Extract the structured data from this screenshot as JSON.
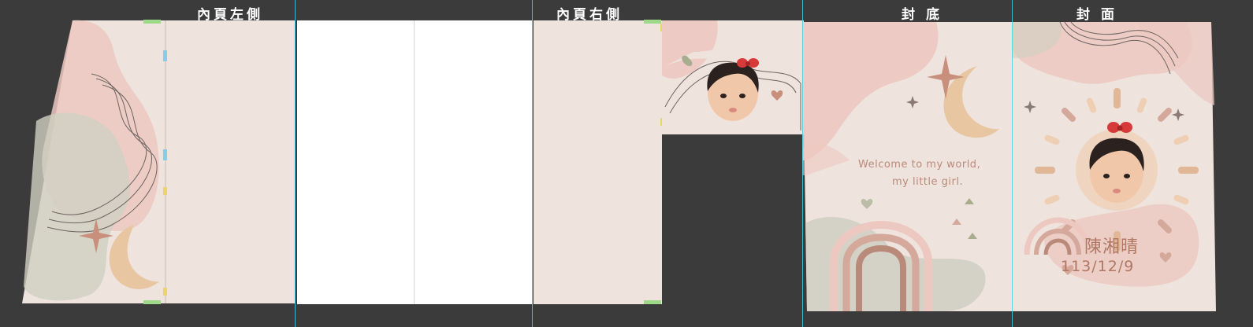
{
  "sections": {
    "inner_left": "內頁左側",
    "inner_right": "內頁右側",
    "back_cover": "封 底",
    "front_cover": "封 面"
  },
  "back_cover": {
    "welcome_line1": "Welcome to my world,",
    "welcome_line2": "my little girl."
  },
  "front_cover": {
    "name": "陳湘晴",
    "date": "113/12/9"
  },
  "colors": {
    "workspace": "#3a3b3a",
    "paper": "#efe3dd",
    "pink_blob": "#ecc8c1",
    "sage_blob": "#cfcfc2",
    "moon": "#e8c6a2",
    "star": "#c8907c",
    "guide": "#3ad6e0"
  },
  "icons": [
    "baby-photo",
    "bow-icon",
    "crescent-moon-icon",
    "four-point-star-icon",
    "rainbow-icon",
    "sun-icon",
    "heart-icon",
    "leaf-icon"
  ]
}
